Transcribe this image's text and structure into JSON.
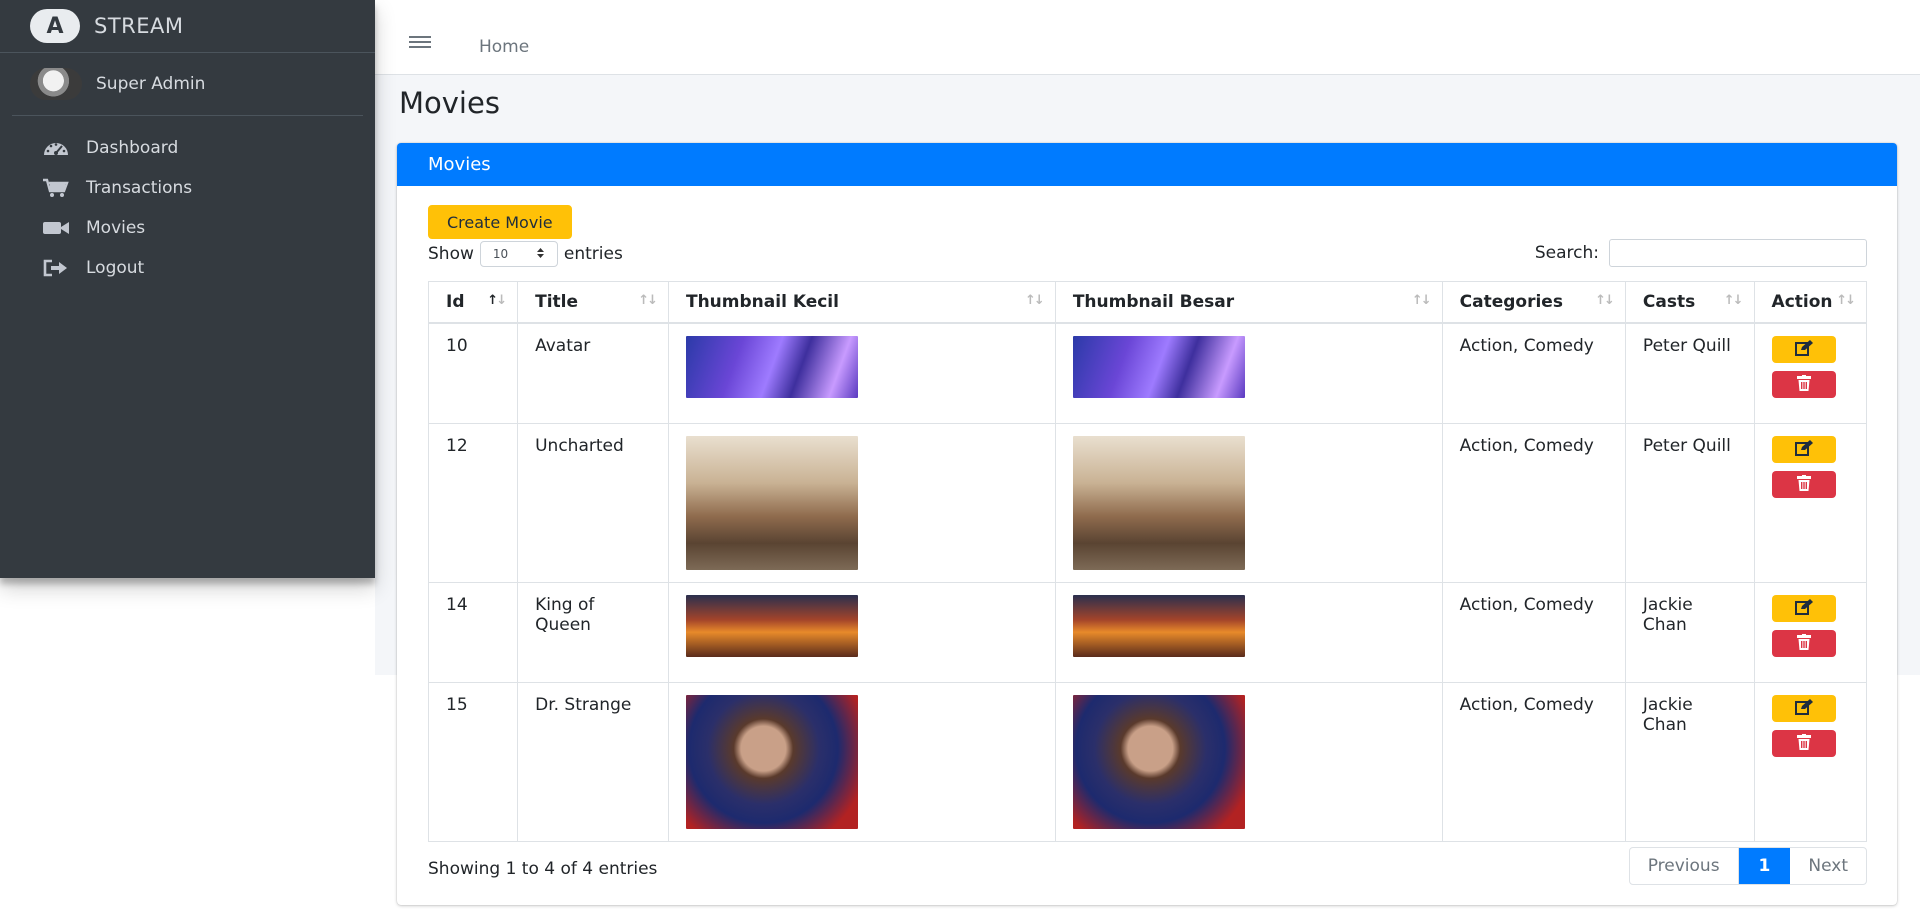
{
  "brand": {
    "logo_text": "A",
    "name": "STREAM"
  },
  "user": {
    "name": "Super Admin"
  },
  "sidebar": {
    "items": [
      {
        "label": "Dashboard",
        "icon": "tachometer-icon"
      },
      {
        "label": "Transactions",
        "icon": "cart-icon"
      },
      {
        "label": "Movies",
        "icon": "video-camera-icon"
      },
      {
        "label": "Logout",
        "icon": "sign-out-icon"
      }
    ]
  },
  "topbar": {
    "home": "Home"
  },
  "page": {
    "title": "Movies"
  },
  "card": {
    "header": "Movies",
    "create_label": "Create Movie"
  },
  "table_controls": {
    "show_label": "Show",
    "entries_label": "entries",
    "page_size": "10",
    "search_label": "Search:",
    "search_value": ""
  },
  "table": {
    "headers": [
      "Id",
      "Title",
      "Thumbnail Kecil",
      "Thumbnail Besar",
      "Categories",
      "Casts",
      "Action"
    ],
    "rows": [
      {
        "id": "10",
        "title": "Avatar",
        "categories": "Action, Comedy",
        "casts": "Peter Quill"
      },
      {
        "id": "12",
        "title": "Uncharted",
        "categories": "Action, Comedy",
        "casts": "Peter Quill"
      },
      {
        "id": "14",
        "title": "King of Queen",
        "categories": "Action, Comedy",
        "casts": "Jackie Chan"
      },
      {
        "id": "15",
        "title": "Dr. Strange",
        "categories": "Action, Comedy",
        "casts": "Jackie Chan"
      }
    ]
  },
  "footer": {
    "info": "Showing 1 to 4 of 4 entries",
    "previous": "Previous",
    "page": "1",
    "next": "Next"
  },
  "colors": {
    "sidebar_bg": "#343a40",
    "primary": "#007bff",
    "warning": "#ffc107",
    "danger": "#dc3545"
  }
}
